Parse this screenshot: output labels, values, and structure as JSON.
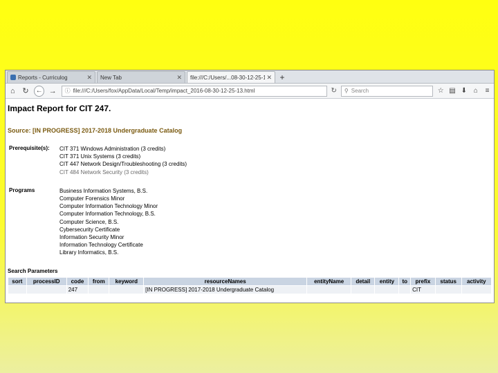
{
  "browser": {
    "tabs": [
      {
        "title": "Reports - Curriculog",
        "active": false
      },
      {
        "title": "New Tab",
        "active": false
      },
      {
        "title": "file:///C:/Users/...08-30-12-25-13.html",
        "active": true
      }
    ],
    "new_tab_glyph": "+",
    "url": "file:///C:/Users/fox/AppData/Local/Temp/impact_2016-08-30-12-25-13.html",
    "search_placeholder": "Search",
    "accent_color": "#7a5a10"
  },
  "report": {
    "title": "Impact Report for CIT 247.",
    "source": "Source: [IN PROGRESS] 2017-2018 Undergraduate Catalog",
    "prerequisites": {
      "label": "Prerequisite(s):",
      "items": [
        "CIT 371 Windows Administration (3 credits)",
        "CIT 371 Unix Systems (3 credits)",
        "CIT 447 Network Design/Troubleshooting (3 credits)",
        "CIT 484 Network Security (3 credits)"
      ]
    },
    "programs": {
      "label": "Programs",
      "items": [
        "Business Information Systems, B.S.",
        "Computer Forensics Minor",
        "Computer Information Technology Minor",
        "Computer Information Technology, B.S.",
        "Computer Science, B.S.",
        "Cybersecurity Certificate",
        "Information Security Minor",
        "Information Technology Certificate",
        "Library Informatics, B.S."
      ]
    },
    "search_parameters": {
      "title": "Search Parameters",
      "columns": [
        "sort",
        "processID",
        "code",
        "from",
        "keyword",
        "resourceNames",
        "entityName",
        "detail",
        "entity",
        "to",
        "prefix",
        "status",
        "activity"
      ],
      "rows": [
        [
          "",
          "",
          "247",
          "",
          "",
          "[IN PROGRESS] 2017-2018 Undergraduate Catalog",
          "",
          "",
          "",
          "",
          "CIT",
          "",
          ""
        ]
      ]
    }
  }
}
